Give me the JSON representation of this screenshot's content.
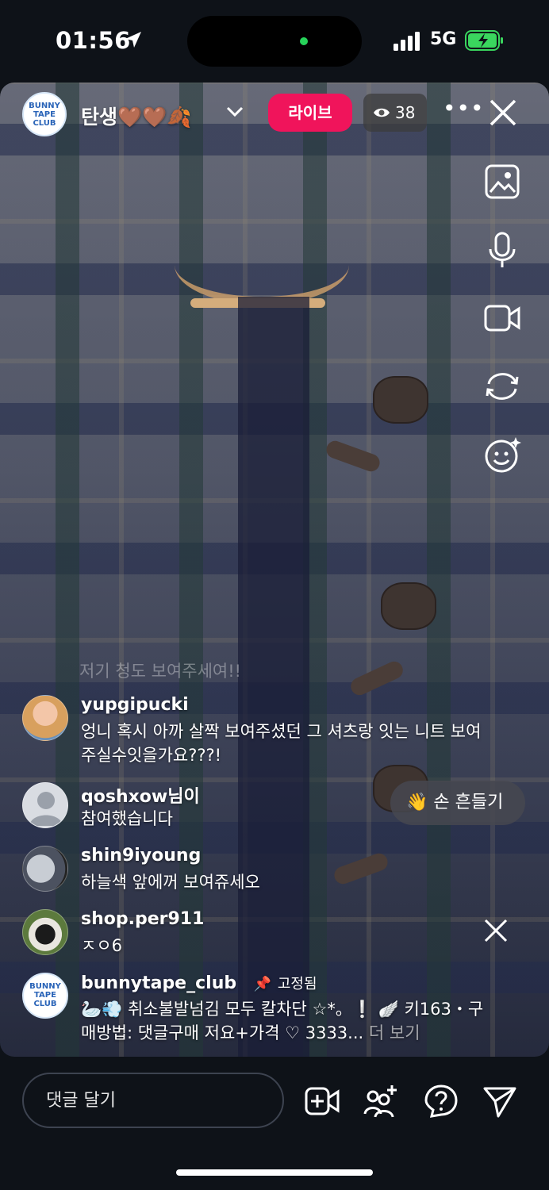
{
  "status_bar": {
    "time": "01:56",
    "network": "5G",
    "battery_color": "#3ad65e"
  },
  "live": {
    "channel_name": "탄생🤎🤎🍂",
    "live_label": "라이브",
    "viewer_count": "38",
    "more_label": "•••",
    "accent": "#f0145b"
  },
  "comments": {
    "faded_text": "저기 청도 보여주세여!!",
    "items": [
      {
        "user": "yupgipucki",
        "text": "엉니 혹시 아까 살짝 보여주셨던 그 셔츠랑 잇는 니트 보여주실수잇을가요???!"
      },
      {
        "user": "qoshxow님이",
        "text": "참여했습니다"
      },
      {
        "user": "shin9iyoung",
        "text": "하늘색 앞에꺼 보여쥬세오"
      },
      {
        "user": "shop.per911",
        "text": "ㅈㅇ6"
      }
    ],
    "pinned": {
      "user": "bunnytape_club",
      "pinned_label": "고정됨",
      "text": "🦢💨 취소불발넘김 모두 칼차단 ☆*。❕ 🪽 키163・구매방법: 댓글구매 저요+가격 ♡ 3333...",
      "more_label": "더 보기"
    },
    "wave_label": "👋 손 흔들기"
  },
  "bottom": {
    "comment_placeholder": "댓글 달기"
  },
  "logo_text": "BUNNY TAPE CLUB"
}
